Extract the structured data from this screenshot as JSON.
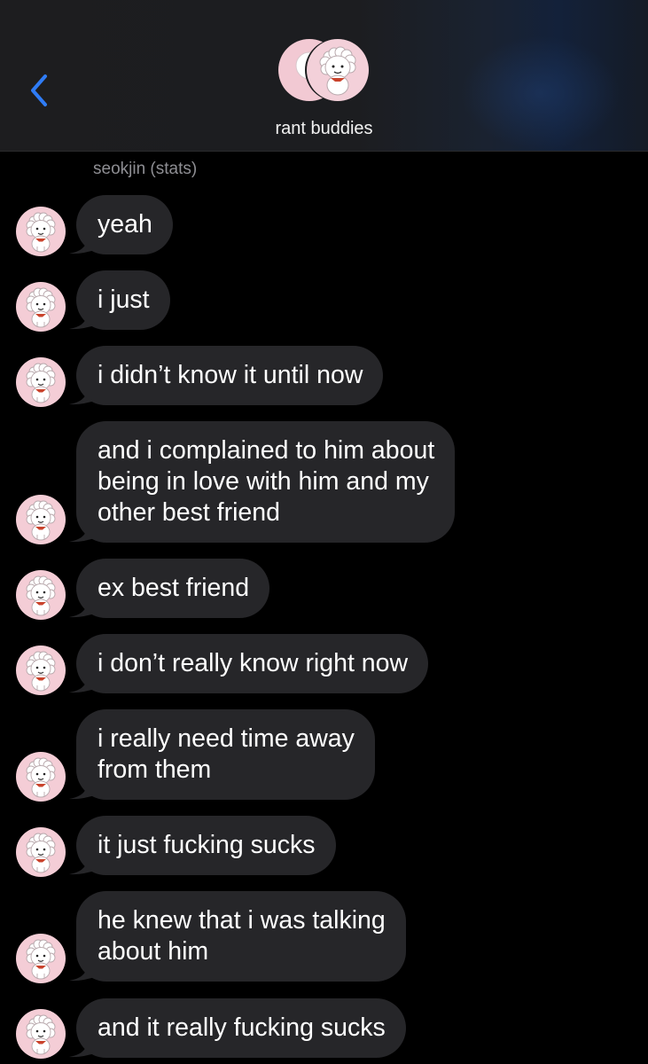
{
  "header": {
    "back_label": "Back",
    "title": "rant buddies"
  },
  "sender_name": "seokjin (stats)",
  "colors": {
    "bubble": "#262629",
    "accent": "#2f7cf6",
    "avatar_bg": "#f4cdd6"
  },
  "messages": [
    {
      "text": "yeah"
    },
    {
      "text": "i just"
    },
    {
      "text": "i didn’t know it until now"
    },
    {
      "text": "and i complained to him about\nbeing in love with him and my\nother best friend"
    },
    {
      "text": "ex best friend"
    },
    {
      "text": "i don’t really know right now"
    },
    {
      "text": "i really need time away\nfrom them"
    },
    {
      "text": "it just fucking sucks"
    },
    {
      "text": "he knew that i was talking\nabout him"
    },
    {
      "text": "and it really fucking sucks"
    }
  ]
}
